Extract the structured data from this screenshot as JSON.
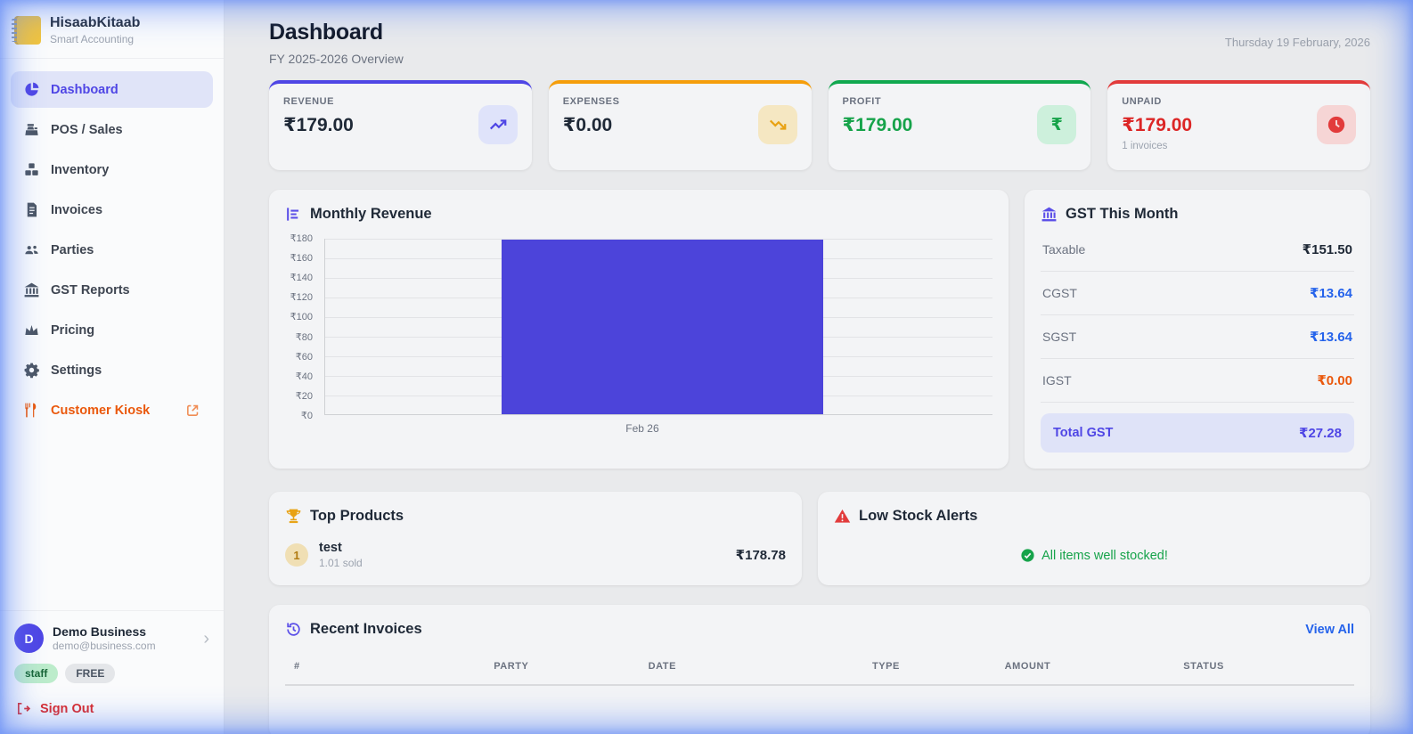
{
  "app": {
    "name": "HisaabKitaab",
    "tagline": "Smart Accounting"
  },
  "sidebar": {
    "items": [
      {
        "label": "Dashboard",
        "icon": "pie-chart-icon",
        "active": true
      },
      {
        "label": "POS / Sales",
        "icon": "cash-register-icon"
      },
      {
        "label": "Inventory",
        "icon": "boxes-icon"
      },
      {
        "label": "Invoices",
        "icon": "invoice-icon"
      },
      {
        "label": "Parties",
        "icon": "people-icon"
      },
      {
        "label": "GST Reports",
        "icon": "bank-icon"
      },
      {
        "label": "Pricing",
        "icon": "crown-icon"
      },
      {
        "label": "Settings",
        "icon": "gear-icon"
      },
      {
        "label": "Customer Kiosk",
        "icon": "utensils-icon",
        "external": true
      }
    ],
    "profile": {
      "initial": "D",
      "name": "Demo Business",
      "email": "demo@business.com"
    },
    "badges": {
      "role": "staff",
      "plan": "FREE"
    },
    "signout_label": "Sign Out"
  },
  "header": {
    "title": "Dashboard",
    "subtitle": "FY 2025-2026 Overview",
    "date": "Thursday 19 February, 2026"
  },
  "stats": [
    {
      "label": "REVENUE",
      "value": "₹179.00",
      "icon": "trend-up-icon",
      "accent": "#4f46e5"
    },
    {
      "label": "EXPENSES",
      "value": "₹0.00",
      "icon": "trend-down-icon",
      "accent": "#f59e0b"
    },
    {
      "label": "PROFIT",
      "value": "₹179.00",
      "icon": "rupee-icon",
      "accent": "#16a34a"
    },
    {
      "label": "UNPAID",
      "value": "₹179.00",
      "sub": "1 invoices",
      "icon": "clock-icon",
      "accent": "#dc2626"
    }
  ],
  "chart_data": {
    "type": "bar",
    "title": "Monthly Revenue",
    "categories": [
      "Feb 26"
    ],
    "values": [
      179
    ],
    "ylim": [
      0,
      180
    ],
    "ytick_step": 20,
    "ytick_labels": [
      "₹180",
      "₹160",
      "₹140",
      "₹120",
      "₹100",
      "₹80",
      "₹60",
      "₹40",
      "₹20",
      "₹0"
    ],
    "bar_color": "#4c44da",
    "grid": true,
    "legend": false
  },
  "gst": {
    "title": "GST This Month",
    "rows": [
      {
        "label": "Taxable",
        "value": "₹151.50",
        "color": "#1f2937"
      },
      {
        "label": "CGST",
        "value": "₹13.64",
        "color": "#2563eb"
      },
      {
        "label": "SGST",
        "value": "₹13.64",
        "color": "#2563eb"
      },
      {
        "label": "IGST",
        "value": "₹0.00",
        "color": "#ea580c"
      }
    ],
    "total": {
      "label": "Total GST",
      "value": "₹27.28",
      "color": "#4f46e5"
    }
  },
  "top_products": {
    "title": "Top Products",
    "items": [
      {
        "rank": "1",
        "name": "test",
        "sold": "1.01 sold",
        "amount": "₹178.78"
      }
    ]
  },
  "low_stock": {
    "title": "Low Stock Alerts",
    "message": "All items well stocked!"
  },
  "recent_invoices": {
    "title": "Recent Invoices",
    "view_all": "View All",
    "columns": [
      "#",
      "PARTY",
      "DATE",
      "TYPE",
      "AMOUNT",
      "STATUS"
    ]
  }
}
